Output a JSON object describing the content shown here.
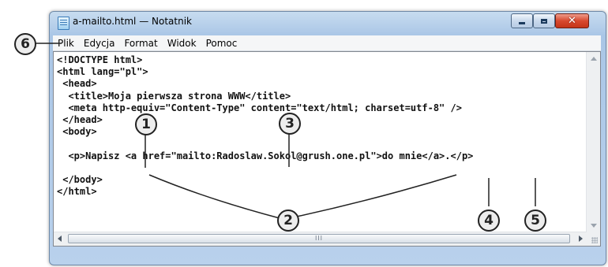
{
  "window": {
    "title": "a-mailto.html — Notatnik",
    "close_glyph": "✕"
  },
  "menu": [
    "Plik",
    "Edycja",
    "Format",
    "Widok",
    "Pomoc"
  ],
  "editor": {
    "lines": [
      "<!DOCTYPE html>",
      "<html lang=\"pl\">",
      " <head>",
      "  <title>Moja pierwsza strona WWW</title>",
      "  <meta http-equiv=\"Content-Type\" content=\"text/html; charset=utf-8\" />",
      " </head>",
      " <body>",
      "",
      "  <p>Napisz <a href=\"mailto:Radoslaw.Sokol@grush.one.pl\">do mnie</a>.</p>",
      "",
      " </body>",
      "</html>"
    ],
    "scroll_grip": "III"
  },
  "callouts": [
    "1",
    "2",
    "3",
    "4",
    "5",
    "6"
  ]
}
